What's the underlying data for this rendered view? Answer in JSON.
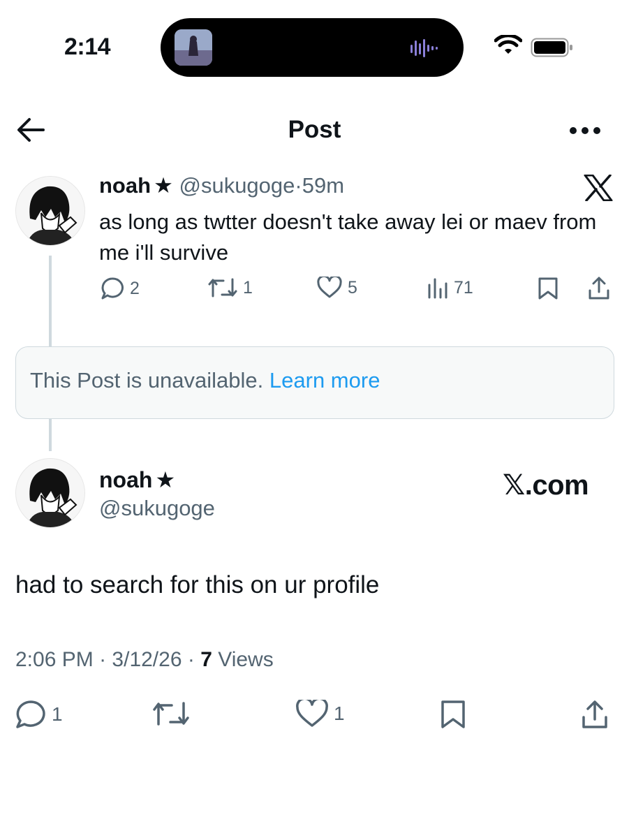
{
  "status_bar": {
    "time": "2:14"
  },
  "header": {
    "title": "Post",
    "back_icon": "arrow-left-icon",
    "more_icon": "more-dots-icon"
  },
  "quoted_post": {
    "display_name": "noah",
    "badge": "★",
    "handle": "@sukugoge",
    "separator": "·",
    "time_ago": "59m",
    "text": "as long as twtter doesn't take away lei or maev from me i'll survive",
    "replies": "2",
    "reposts": "1",
    "likes": "5",
    "views": "71"
  },
  "unavailable": {
    "message": "This Post is unavailable.",
    "link": "Learn more"
  },
  "main_post": {
    "display_name": "noah",
    "badge": "★",
    "handle": "@sukugoge",
    "watermark": "𝕏.com",
    "text": "had to search for this on ur profile",
    "time": "2:06 PM",
    "sep1": "·",
    "date": "3/12/26",
    "sep2": "·",
    "views_count": "7",
    "views_label": "Views",
    "replies": "1",
    "likes": "1"
  },
  "colors": {
    "text": "#0f1419",
    "muted": "#536471",
    "link": "#1d9bf0",
    "card_bg": "#f7f9f9",
    "border": "#cfd9de"
  }
}
